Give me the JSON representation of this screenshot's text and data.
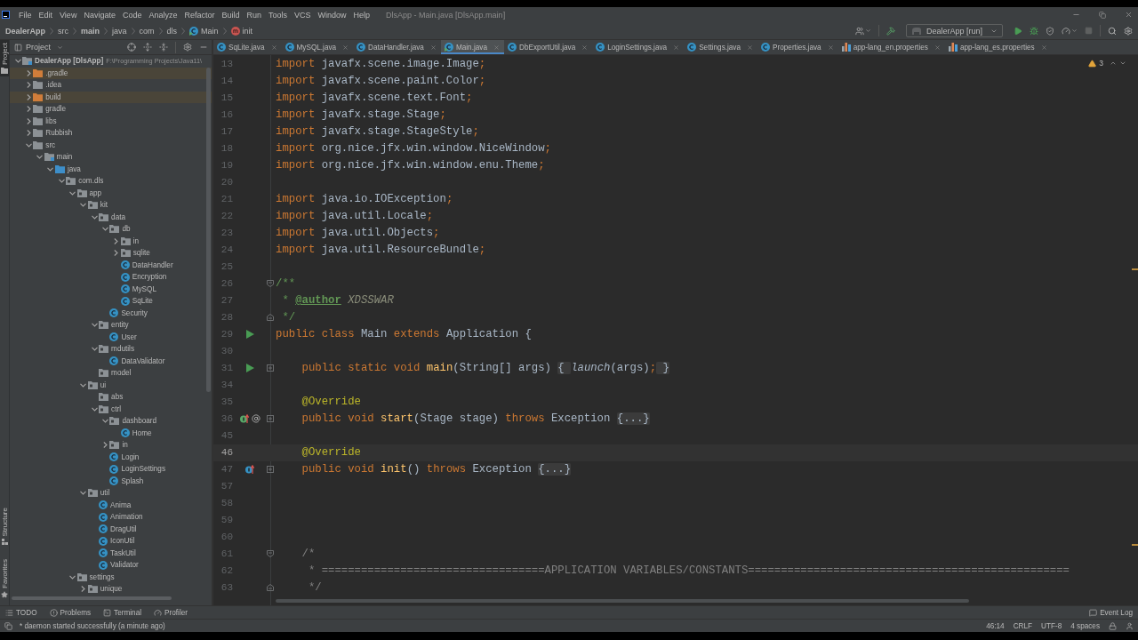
{
  "menu_bar": {
    "items": [
      "File",
      "Edit",
      "View",
      "Navigate",
      "Code",
      "Analyze",
      "Refactor",
      "Build",
      "Run",
      "Tools",
      "VCS",
      "Window",
      "Help"
    ],
    "window_title": "DlsApp - Main.java [DlsApp.main]"
  },
  "nav_bar": {
    "breadcrumbs": [
      {
        "label": "DealerApp",
        "kind": "project"
      },
      {
        "label": "src",
        "kind": "folder"
      },
      {
        "label": "main",
        "kind": "module"
      },
      {
        "label": "java",
        "kind": "folder"
      },
      {
        "label": "com",
        "kind": "folder"
      },
      {
        "label": "dls",
        "kind": "folder"
      },
      {
        "label": "Main",
        "kind": "class"
      },
      {
        "label": "init",
        "kind": "method"
      }
    ],
    "run_config": "DealerApp [run]"
  },
  "left_stripe": {
    "top": [
      {
        "label": "Project",
        "kind": "project",
        "selected": true
      }
    ],
    "bottom": [
      {
        "label": "Structure",
        "kind": "structure",
        "selected": false
      },
      {
        "label": "Favorites",
        "kind": "favorites",
        "selected": false
      }
    ]
  },
  "project_panel": {
    "title": "Project",
    "tree": [
      {
        "label": "DealerApp [DlsApp]",
        "kind": "module",
        "path": "F:\\Programming Projects\\Java11\\",
        "expanded": true,
        "children": [
          {
            "label": ".gradle",
            "kind": "excluded",
            "expanded": false
          },
          {
            "label": ".idea",
            "kind": "folder",
            "expanded": false
          },
          {
            "label": "build",
            "kind": "excluded",
            "expanded": false
          },
          {
            "label": "gradle",
            "kind": "folder",
            "expanded": false
          },
          {
            "label": "libs",
            "kind": "folder",
            "expanded": false
          },
          {
            "label": "Rubbish",
            "kind": "folder",
            "expanded": false
          },
          {
            "label": "src",
            "kind": "folder",
            "expanded": true,
            "children": [
              {
                "label": "main",
                "kind": "source-set",
                "expanded": true,
                "children": [
                  {
                    "label": "java",
                    "kind": "source-root",
                    "expanded": true,
                    "children": [
                      {
                        "label": "com.dls",
                        "kind": "package",
                        "expanded": true,
                        "children": [
                          {
                            "label": "app",
                            "kind": "package",
                            "expanded": true,
                            "children": [
                              {
                                "label": "kit",
                                "kind": "package",
                                "expanded": true,
                                "children": [
                                  {
                                    "label": "data",
                                    "kind": "package",
                                    "expanded": true,
                                    "children": [
                                      {
                                        "label": "db",
                                        "kind": "package",
                                        "expanded": true,
                                        "children": [
                                          {
                                            "label": "in",
                                            "kind": "package",
                                            "expanded": false
                                          },
                                          {
                                            "label": "sqlite",
                                            "kind": "package",
                                            "expanded": false
                                          },
                                          {
                                            "label": "DataHandler",
                                            "kind": "class"
                                          },
                                          {
                                            "label": "Encryption",
                                            "kind": "class"
                                          },
                                          {
                                            "label": "MySQL",
                                            "kind": "class"
                                          },
                                          {
                                            "label": "SqLite",
                                            "kind": "class"
                                          }
                                        ]
                                      },
                                      {
                                        "label": "Security",
                                        "kind": "class"
                                      }
                                    ]
                                  },
                                  {
                                    "label": "entity",
                                    "kind": "package",
                                    "expanded": true,
                                    "children": [
                                      {
                                        "label": "User",
                                        "kind": "class"
                                      }
                                    ]
                                  },
                                  {
                                    "label": "mdutils",
                                    "kind": "package",
                                    "expanded": true,
                                    "children": [
                                      {
                                        "label": "DataValidator",
                                        "kind": "class"
                                      }
                                    ]
                                  },
                                  {
                                    "label": "model",
                                    "kind": "package"
                                  }
                                ]
                              },
                              {
                                "label": "ui",
                                "kind": "package",
                                "expanded": true,
                                "children": [
                                  {
                                    "label": "abs",
                                    "kind": "package"
                                  },
                                  {
                                    "label": "ctrl",
                                    "kind": "package",
                                    "expanded": true,
                                    "children": [
                                      {
                                        "label": "dashboard",
                                        "kind": "package",
                                        "expanded": true,
                                        "children": [
                                          {
                                            "label": "Home",
                                            "kind": "class"
                                          }
                                        ]
                                      },
                                      {
                                        "label": "in",
                                        "kind": "package",
                                        "expanded": false
                                      },
                                      {
                                        "label": "Login",
                                        "kind": "class"
                                      },
                                      {
                                        "label": "LoginSettings",
                                        "kind": "class"
                                      },
                                      {
                                        "label": "Splash",
                                        "kind": "class"
                                      }
                                    ]
                                  }
                                ]
                              },
                              {
                                "label": "util",
                                "kind": "package",
                                "expanded": true,
                                "children": [
                                  {
                                    "label": "Anima",
                                    "kind": "class"
                                  },
                                  {
                                    "label": "Animation",
                                    "kind": "class"
                                  },
                                  {
                                    "label": "DragUtil",
                                    "kind": "class"
                                  },
                                  {
                                    "label": "IconUtil",
                                    "kind": "class"
                                  },
                                  {
                                    "label": "TaskUtil",
                                    "kind": "class"
                                  },
                                  {
                                    "label": "Validator",
                                    "kind": "class"
                                  }
                                ]
                              }
                            ]
                          },
                          {
                            "label": "settings",
                            "kind": "package",
                            "expanded": true,
                            "children": [
                              {
                                "label": "unique",
                                "kind": "package",
                                "expanded": false
                              }
                            ]
                          }
                        ]
                      }
                    ]
                  }
                ]
              }
            ]
          }
        ]
      }
    ]
  },
  "editor": {
    "tabs": [
      {
        "label": "SqLite.java",
        "kind": "class",
        "selected": false
      },
      {
        "label": "MySQL.java",
        "kind": "class",
        "selected": false
      },
      {
        "label": "DataHandler.java",
        "kind": "class",
        "selected": false
      },
      {
        "label": "Main.java",
        "kind": "runnable",
        "selected": true
      },
      {
        "label": "DbExportUtil.java",
        "kind": "class",
        "selected": false
      },
      {
        "label": "LoginSettings.java",
        "kind": "class",
        "selected": false
      },
      {
        "label": "Settings.java",
        "kind": "class",
        "selected": false
      },
      {
        "label": "Properties.java",
        "kind": "class",
        "selected": false
      },
      {
        "label": "app-lang_en.properties",
        "kind": "properties",
        "selected": false
      },
      {
        "label": "app-lang_es.properties",
        "kind": "properties",
        "selected": false
      }
    ],
    "warning_count": "3",
    "lines": [
      {
        "number": "13",
        "current": false,
        "tokens": [
          {
            "kind": "keyword",
            "text": "import"
          },
          {
            "kind": "plain",
            "text": " javafx.scene.image.Image"
          },
          {
            "kind": "keyword",
            "text": ";"
          }
        ]
      },
      {
        "number": "14",
        "current": false,
        "tokens": [
          {
            "kind": "keyword",
            "text": "import"
          },
          {
            "kind": "plain",
            "text": " javafx.scene.paint.Color"
          },
          {
            "kind": "keyword",
            "text": ";"
          }
        ]
      },
      {
        "number": "15",
        "current": false,
        "tokens": [
          {
            "kind": "keyword",
            "text": "import"
          },
          {
            "kind": "plain",
            "text": " javafx.scene.text.Font"
          },
          {
            "kind": "keyword",
            "text": ";"
          }
        ]
      },
      {
        "number": "16",
        "current": false,
        "tokens": [
          {
            "kind": "keyword",
            "text": "import"
          },
          {
            "kind": "plain",
            "text": " javafx.stage.Stage"
          },
          {
            "kind": "keyword",
            "text": ";"
          }
        ]
      },
      {
        "number": "17",
        "current": false,
        "tokens": [
          {
            "kind": "keyword",
            "text": "import"
          },
          {
            "kind": "plain",
            "text": " javafx.stage.StageStyle"
          },
          {
            "kind": "keyword",
            "text": ";"
          }
        ]
      },
      {
        "number": "18",
        "current": false,
        "tokens": [
          {
            "kind": "keyword",
            "text": "import"
          },
          {
            "kind": "plain",
            "text": " org.nice.jfx.win.window.NiceWindow"
          },
          {
            "kind": "keyword",
            "text": ";"
          }
        ]
      },
      {
        "number": "19",
        "current": false,
        "tokens": [
          {
            "kind": "keyword",
            "text": "import"
          },
          {
            "kind": "plain",
            "text": " org.nice.jfx.win.window.enu.Theme"
          },
          {
            "kind": "keyword",
            "text": ";"
          }
        ]
      },
      {
        "number": "20",
        "current": false
      },
      {
        "number": "21",
        "current": false,
        "tokens": [
          {
            "kind": "keyword",
            "text": "import"
          },
          {
            "kind": "plain",
            "text": " java.io.IOException"
          },
          {
            "kind": "keyword",
            "text": ";"
          }
        ]
      },
      {
        "number": "22",
        "current": false,
        "tokens": [
          {
            "kind": "keyword",
            "text": "import"
          },
          {
            "kind": "plain",
            "text": " java.util.Locale"
          },
          {
            "kind": "keyword",
            "text": ";"
          }
        ]
      },
      {
        "number": "23",
        "current": false,
        "tokens": [
          {
            "kind": "keyword",
            "text": "import"
          },
          {
            "kind": "plain",
            "text": " java.util.Objects"
          },
          {
            "kind": "keyword",
            "text": ";"
          }
        ]
      },
      {
        "number": "24",
        "current": false,
        "tokens": [
          {
            "kind": "keyword",
            "text": "import"
          },
          {
            "kind": "plain",
            "text": " java.util.ResourceBundle"
          },
          {
            "kind": "keyword",
            "text": ";"
          }
        ]
      },
      {
        "number": "25",
        "current": false
      },
      {
        "number": "26",
        "current": false,
        "fold": {
          "kind": "start"
        },
        "tokens": [
          {
            "kind": "doc",
            "text": "/**"
          }
        ]
      },
      {
        "number": "27",
        "current": false,
        "tokens": [
          {
            "kind": "doc",
            "text": " * "
          },
          {
            "kind": "doc-tag",
            "text": "@author"
          },
          {
            "kind": "doc-value",
            "text": " XDSSWAR"
          }
        ]
      },
      {
        "number": "28",
        "current": false,
        "fold": {
          "kind": "end"
        },
        "tokens": [
          {
            "kind": "doc",
            "text": " */"
          }
        ]
      },
      {
        "number": "29",
        "current": false,
        "markers": [
          {
            "kind": "run"
          }
        ],
        "tokens": [
          {
            "kind": "keyword",
            "text": "public class "
          },
          {
            "kind": "plain",
            "text": "Main "
          },
          {
            "kind": "keyword",
            "text": "extends "
          },
          {
            "kind": "plain",
            "text": "Application {"
          }
        ]
      },
      {
        "number": "30",
        "current": false
      },
      {
        "number": "31",
        "current": false,
        "markers": [
          {
            "kind": "run"
          }
        ],
        "fold": {
          "kind": "collapsed"
        },
        "tokens": [
          {
            "kind": "keyword",
            "text": "    public static void "
          },
          {
            "kind": "method",
            "text": "main"
          },
          {
            "kind": "plain",
            "text": "(String[] args) "
          },
          {
            "kind": "fold",
            "text": "{ "
          },
          {
            "kind": "static-call",
            "text": "launch"
          },
          {
            "kind": "plain",
            "text": "(args)"
          },
          {
            "kind": "keyword",
            "text": ";"
          },
          {
            "kind": "fold",
            "text": " }"
          }
        ]
      },
      {
        "number": "34",
        "current": false
      },
      {
        "number": "35",
        "current": false,
        "tokens": [
          {
            "kind": "annotation",
            "text": "    @Override"
          }
        ]
      },
      {
        "number": "36",
        "current": false,
        "markers": [
          {
            "kind": "implements"
          },
          {
            "kind": "annotation"
          }
        ],
        "fold": {
          "kind": "collapsed"
        },
        "tokens": [
          {
            "kind": "keyword",
            "text": "    public void "
          },
          {
            "kind": "method",
            "text": "start"
          },
          {
            "kind": "plain",
            "text": "(Stage stage) "
          },
          {
            "kind": "keyword",
            "text": "throws "
          },
          {
            "kind": "plain",
            "text": "Exception "
          },
          {
            "kind": "fold",
            "text": "{...}"
          }
        ]
      },
      {
        "number": "45",
        "current": false
      },
      {
        "number": "46",
        "current": true,
        "tokens": [
          {
            "kind": "annotation",
            "text": "    @Override"
          }
        ]
      },
      {
        "number": "47",
        "current": false,
        "markers": [
          {
            "kind": "overrides"
          }
        ],
        "fold": {
          "kind": "collapsed"
        },
        "tokens": [
          {
            "kind": "keyword",
            "text": "    public void "
          },
          {
            "kind": "method",
            "text": "init"
          },
          {
            "kind": "plain",
            "text": "() "
          },
          {
            "kind": "keyword",
            "text": "throws "
          },
          {
            "kind": "plain",
            "text": "Exception "
          },
          {
            "kind": "fold",
            "text": "{...}"
          }
        ]
      },
      {
        "number": "57",
        "current": false
      },
      {
        "number": "58",
        "current": false
      },
      {
        "number": "59",
        "current": false
      },
      {
        "number": "60",
        "current": false
      },
      {
        "number": "61",
        "current": false,
        "fold": {
          "kind": "start"
        },
        "tokens": [
          {
            "kind": "comment",
            "text": "    /*"
          }
        ]
      },
      {
        "number": "62",
        "current": false,
        "tokens": [
          {
            "kind": "comment",
            "text": "     * ==================================APPLICATION VARIABLES/CONSTANTS================================================="
          }
        ]
      },
      {
        "number": "63",
        "current": false,
        "fold": {
          "kind": "end"
        },
        "tokens": [
          {
            "kind": "comment",
            "text": "     */"
          }
        ]
      }
    ]
  },
  "tool_windows": {
    "left": [
      {
        "label": "TODO",
        "kind": "todo"
      },
      {
        "label": "Problems",
        "kind": "problems"
      },
      {
        "label": "Terminal",
        "kind": "terminal"
      },
      {
        "label": "Profiler",
        "kind": "profiler"
      }
    ],
    "right": [
      {
        "label": "Event Log",
        "kind": "event-log"
      }
    ]
  },
  "status_bar": {
    "message": "* daemon started successfully (a minute ago)",
    "widgets": [
      "46:14",
      "CRLF",
      "UTF-8",
      "4 spaces"
    ]
  }
}
